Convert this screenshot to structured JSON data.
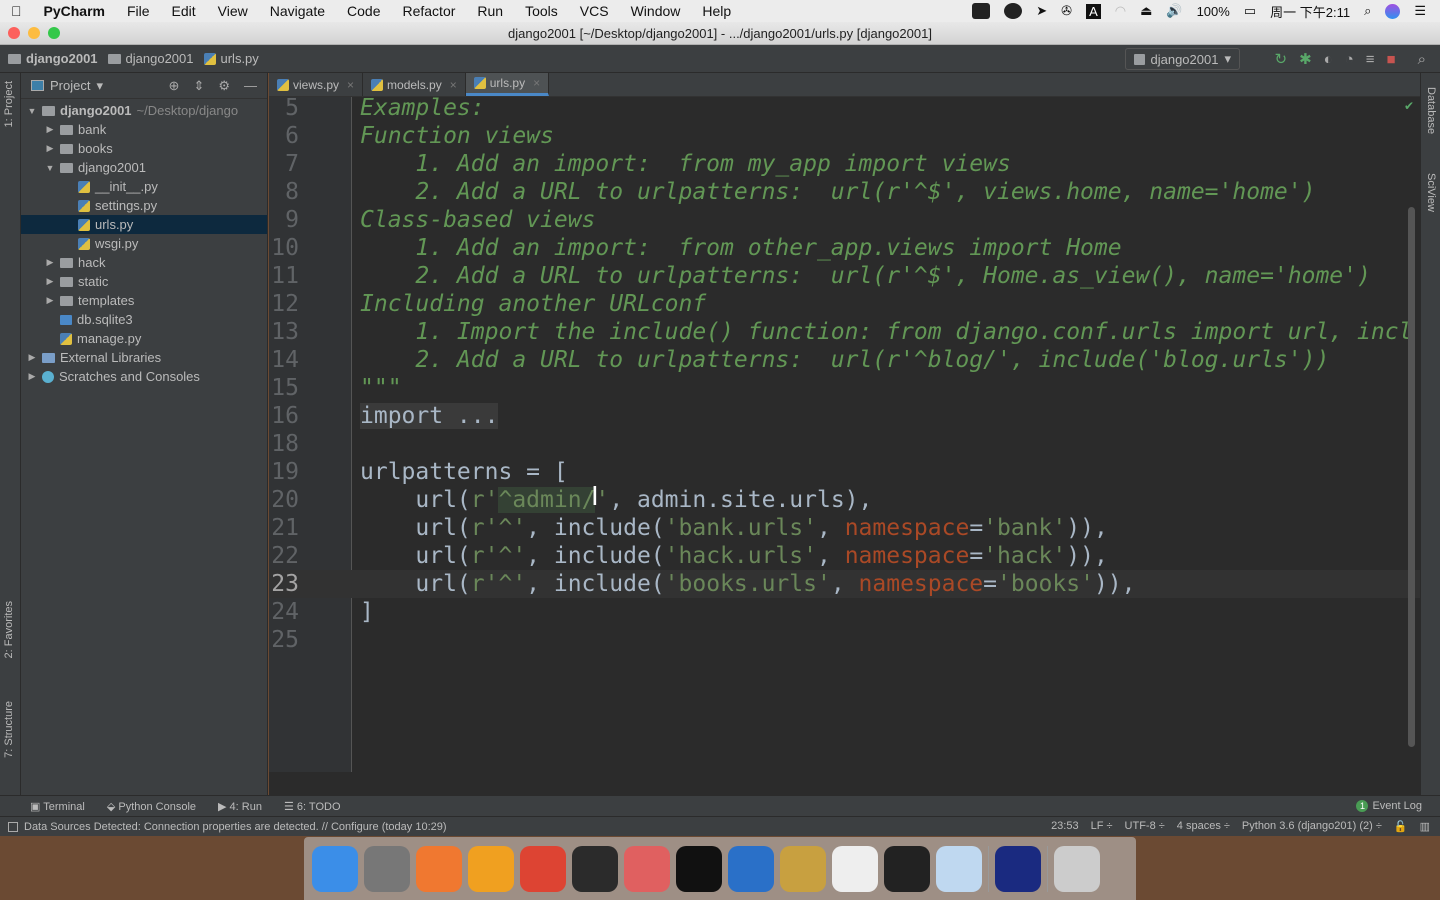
{
  "menubar": {
    "app": "PyCharm",
    "items": [
      "File",
      "Edit",
      "View",
      "Navigate",
      "Code",
      "Refactor",
      "Run",
      "Tools",
      "VCS",
      "Window",
      "Help"
    ],
    "battery": "100%",
    "clock": "周一 下午2:11"
  },
  "window": {
    "title": "django2001 [~/Desktop/django2001] - .../django2001/urls.py [django2001]"
  },
  "breadcrumb": [
    "django2001",
    "django2001",
    "urls.py"
  ],
  "run_config": "django2001",
  "left_strip": {
    "project": "1: Project",
    "favorites": "2: Favorites",
    "structure": "7: Structure"
  },
  "right_strip": {
    "database": "Database",
    "sciview": "SciView"
  },
  "sidebar": {
    "title": "Project",
    "items": [
      {
        "label": "django2001",
        "extra": "~/Desktop/django",
        "depth": 0,
        "arrow": "▼",
        "type": "folder",
        "bold": true
      },
      {
        "label": "bank",
        "depth": 1,
        "arrow": "▶",
        "type": "folder"
      },
      {
        "label": "books",
        "depth": 1,
        "arrow": "▶",
        "type": "folder"
      },
      {
        "label": "django2001",
        "depth": 1,
        "arrow": "▼",
        "type": "folder"
      },
      {
        "label": "__init__.py",
        "depth": 2,
        "type": "py"
      },
      {
        "label": "settings.py",
        "depth": 2,
        "type": "py"
      },
      {
        "label": "urls.py",
        "depth": 2,
        "type": "py",
        "selected": true
      },
      {
        "label": "wsgi.py",
        "depth": 2,
        "type": "py"
      },
      {
        "label": "hack",
        "depth": 1,
        "arrow": "▶",
        "type": "folder"
      },
      {
        "label": "static",
        "depth": 1,
        "arrow": "▶",
        "type": "folder"
      },
      {
        "label": "templates",
        "depth": 1,
        "arrow": "▶",
        "type": "folder"
      },
      {
        "label": "db.sqlite3",
        "depth": 1,
        "type": "db"
      },
      {
        "label": "manage.py",
        "depth": 1,
        "type": "py"
      },
      {
        "label": "External Libraries",
        "depth": 0,
        "arrow": "▶",
        "type": "lib"
      },
      {
        "label": "Scratches and Consoles",
        "depth": 0,
        "arrow": "▶",
        "type": "scratch"
      }
    ]
  },
  "tabs": [
    {
      "label": "views.py"
    },
    {
      "label": "models.py"
    },
    {
      "label": "urls.py",
      "active": true
    }
  ],
  "code": [
    {
      "n": "5",
      "t": [
        [
          "Examples:",
          "doc"
        ]
      ]
    },
    {
      "n": "6",
      "t": [
        [
          "Function views",
          "doc"
        ]
      ]
    },
    {
      "n": "7",
      "t": [
        [
          "    1. Add an import:  from my_app import views",
          "doc"
        ]
      ]
    },
    {
      "n": "8",
      "t": [
        [
          "    2. Add a URL to urlpatterns:  url(r'^$', views.home, name='home')",
          "doc"
        ]
      ]
    },
    {
      "n": "9",
      "t": [
        [
          "Class-based views",
          "doc"
        ]
      ]
    },
    {
      "n": "10",
      "t": [
        [
          "    1. Add an import:  from other_app.views import Home",
          "doc"
        ]
      ]
    },
    {
      "n": "11",
      "t": [
        [
          "    2. Add a URL to urlpatterns:  url(r'^$', Home.as_view(), name='home')",
          "doc"
        ]
      ]
    },
    {
      "n": "12",
      "t": [
        [
          "Including another URLconf",
          "doc"
        ]
      ]
    },
    {
      "n": "13",
      "t": [
        [
          "    1. Import the include() function: from django.conf.urls import url, incl",
          "doc"
        ]
      ]
    },
    {
      "n": "14",
      "t": [
        [
          "    2. Add a URL to urlpatterns:  url(r'^blog/', include('blog.urls'))",
          "doc"
        ]
      ]
    },
    {
      "n": "15",
      "t": [
        [
          "\"\"\"",
          "doc"
        ]
      ]
    },
    {
      "n": "16",
      "t": [
        [
          "import ...",
          "fld"
        ]
      ]
    },
    {
      "n": "18",
      "t": []
    },
    {
      "n": "19",
      "t": [
        [
          "urlpatterns = [",
          "n"
        ]
      ]
    },
    {
      "n": "20",
      "t": [
        [
          "    url(",
          "n"
        ],
        [
          "r'",
          "s"
        ],
        [
          "^admin/",
          "s hl"
        ],
        [
          "'",
          "s"
        ],
        [
          ", admin.site.urls),",
          "n"
        ]
      ]
    },
    {
      "n": "21",
      "t": [
        [
          "    url(",
          "n"
        ],
        [
          "r'^'",
          "s"
        ],
        [
          ", include(",
          "n"
        ],
        [
          "'bank.urls'",
          "s"
        ],
        [
          ", ",
          "n"
        ],
        [
          "namespace",
          "k"
        ],
        [
          "=",
          "n"
        ],
        [
          "'bank'",
          "s"
        ],
        [
          ")),",
          "n"
        ]
      ]
    },
    {
      "n": "22",
      "t": [
        [
          "    url(",
          "n"
        ],
        [
          "r'^'",
          "s"
        ],
        [
          ", include(",
          "n"
        ],
        [
          "'hack.urls'",
          "s"
        ],
        [
          ", ",
          "n"
        ],
        [
          "namespace",
          "k"
        ],
        [
          "=",
          "n"
        ],
        [
          "'hack'",
          "s"
        ],
        [
          ")),",
          "n"
        ]
      ]
    },
    {
      "n": "23",
      "t": [
        [
          "    url(",
          "n"
        ],
        [
          "r'^'",
          "s"
        ],
        [
          ", include(",
          "n"
        ],
        [
          "'books.urls'",
          "s"
        ],
        [
          ", ",
          "n"
        ],
        [
          "namespace",
          "k"
        ],
        [
          "=",
          "n"
        ],
        [
          "'books'",
          "s"
        ],
        [
          ")),",
          "n"
        ]
      ],
      "current": true
    },
    {
      "n": "24",
      "t": [
        [
          "]",
          "n"
        ]
      ]
    },
    {
      "n": "25",
      "t": []
    }
  ],
  "bottom_tabs": [
    "Terminal",
    "Python Console",
    "4: Run",
    "6: TODO"
  ],
  "event_log": {
    "count": "1",
    "label": "Event Log"
  },
  "status": {
    "message": "Data Sources Detected: Connection properties are detected. // Configure (today 10:29)",
    "position": "23:53",
    "line_sep": "LF ÷",
    "encoding": "UTF-8 ÷",
    "indent": "4 spaces ÷",
    "interpreter": "Python 3.6 (django201) (2) ÷"
  },
  "dock_colors": [
    "#3b8ee8",
    "#777",
    "#f07830",
    "#f0a020",
    "#dd4433",
    "#2b2b2b",
    "#e06060",
    "#111",
    "#2a70c8",
    "#c8a040",
    "#eee",
    "#222",
    "#bfd8f0",
    "#1a2a80",
    "#ccc"
  ]
}
